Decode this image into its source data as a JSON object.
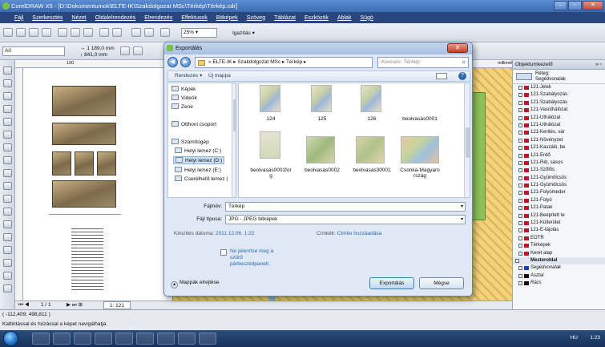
{
  "window": {
    "title": "CorelDRAW X5 - [D:\\Dokumentumok\\ELTE-IK\\Szakdolgozat MSc\\Térkép\\Térkép.cdr]"
  },
  "menu": [
    "Fájl",
    "Szerkesztés",
    "Nézet",
    "Oldalelrendezés",
    "Elrendezés",
    "Effektusok",
    "Bitképek",
    "Szöveg",
    "Táblázat",
    "Eszközök",
    "Ablak",
    "Súgó"
  ],
  "toolbar": {
    "zoom_value": "25%",
    "snap_label": "Igazítás",
    "paper_size": "A0",
    "width_value": "1 189,0 mm",
    "height_value": "841,0 mm"
  },
  "ruler": {
    "unit": "milliméter",
    "mark_100": "100"
  },
  "page_nav": {
    "position": "1 / 1",
    "page_tab": "1: 121"
  },
  "status": {
    "coords": "( -112,409; 498,811 )",
    "hint": "Kattintással és húzással a képet navigálhatja"
  },
  "taskbar": {
    "lang": "HU",
    "clock": "1:23"
  },
  "docker": {
    "title": "Objektumkezelő",
    "layer_head": {
      "line1": "Réteg:",
      "line2": "Segédvonalak"
    },
    "layers": [
      {
        "name": "121-Jelek",
        "color": "#c0142b"
      },
      {
        "name": "121-Szabályozás",
        "color": "#c0142b"
      },
      {
        "name": "121-Szabályozás",
        "color": "#c0142b"
      },
      {
        "name": "121-Vasúthálózat",
        "color": "#c0142b"
      },
      {
        "name": "121-Úthálózat",
        "color": "#c0142b"
      },
      {
        "name": "121-Úthálózat",
        "color": "#c0142b"
      },
      {
        "name": "121-Kerítés, vár",
        "color": "#c0142b"
      },
      {
        "name": "121-Növényzet",
        "color": "#c0142b"
      },
      {
        "name": "121-Kaszáló, be",
        "color": "#c0142b"
      },
      {
        "name": "121-Erdő",
        "color": "#c0142b"
      },
      {
        "name": "121-Rét, sásos",
        "color": "#c0142b"
      },
      {
        "name": "121-Szőlős",
        "color": "#c0142b"
      },
      {
        "name": "121-Gyümölcsös",
        "color": "#c0142b"
      },
      {
        "name": "121-Gyümölcsös",
        "color": "#c0142b"
      },
      {
        "name": "121-Folyómeder",
        "color": "#c0142b"
      },
      {
        "name": "121-Folyó",
        "color": "#c0142b"
      },
      {
        "name": "121-Patak",
        "color": "#c0142b"
      },
      {
        "name": "121-Beépített te",
        "color": "#c0142b"
      },
      {
        "name": "121-Külterület",
        "color": "#c0142b"
      },
      {
        "name": "121-É-tájolás",
        "color": "#c0142b"
      },
      {
        "name": "EOTR",
        "color": "#c0142b"
      },
      {
        "name": "Térképek",
        "color": "#c0142b"
      },
      {
        "name": "Keret alap",
        "color": "#c0142b"
      }
    ],
    "master_group": "Mesteroldal",
    "master_layers": [
      {
        "name": "Segédvonalak",
        "color": "#1a3ccc"
      },
      {
        "name": "Asztal",
        "color": "#111111"
      },
      {
        "name": "Rács",
        "color": "#111111"
      }
    ]
  },
  "dialog": {
    "title": "Exportálás",
    "breadcrumb": "« ELTE-IK ▸ Szakdolgozat MSc ▸ Térkép ▸",
    "search_placeholder": "Keresés: Térkép",
    "cmd_organize": "Rendezés ▾",
    "cmd_new_folder": "Új mappa",
    "nav_items": [
      {
        "label": "Képek"
      },
      {
        "label": "Videók"
      },
      {
        "label": "Zene"
      },
      {
        "label": "Otthoni csoport"
      },
      {
        "label": "Számítógép"
      },
      {
        "label": "Helyi lemez (C:)"
      },
      {
        "label": "Helyi lemez (D:)"
      },
      {
        "label": "Helyi lemez (E:)"
      },
      {
        "label": "Cserélhető lemez ("
      }
    ],
    "files": [
      {
        "name": "124"
      },
      {
        "name": "125"
      },
      {
        "name": "126"
      },
      {
        "name": "beolvasás0001"
      },
      {
        "name": "beolvasás0001for\ng"
      },
      {
        "name": "beolvasás0002"
      },
      {
        "name": "beolvasás30001"
      },
      {
        "name": "Csonka-Magyaro\nrszág"
      }
    ],
    "filename_label": "Fájlnév:",
    "filename_value": "Térkép",
    "filetype_label": "Fájl típusa:",
    "filetype_value": "JPG - JPEG bitképek",
    "date_label": "Készítés dátuma:",
    "date_value": "2011.12.06. 1:22",
    "tags_label": "Címkék:",
    "tags_value": "Címke hozzáadása",
    "checkbox_label": "Ne jelenítse meg a szűrő párbeszédpanelt.",
    "hide_folders": "Mappák elrejtése",
    "export_button": "Exportálás",
    "cancel_button": "Mégse"
  }
}
